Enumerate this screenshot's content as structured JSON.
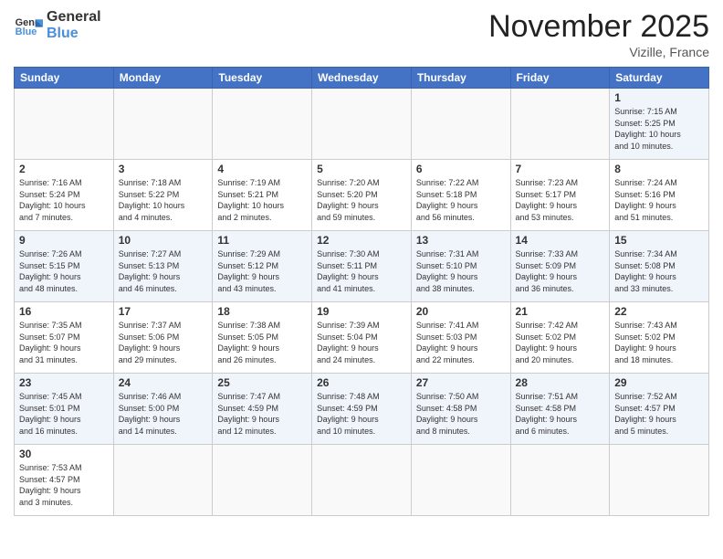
{
  "header": {
    "logo_general": "General",
    "logo_blue": "Blue",
    "month_title": "November 2025",
    "location": "Vizille, France"
  },
  "weekdays": [
    "Sunday",
    "Monday",
    "Tuesday",
    "Wednesday",
    "Thursday",
    "Friday",
    "Saturday"
  ],
  "weeks": [
    [
      {
        "day": "",
        "info": ""
      },
      {
        "day": "",
        "info": ""
      },
      {
        "day": "",
        "info": ""
      },
      {
        "day": "",
        "info": ""
      },
      {
        "day": "",
        "info": ""
      },
      {
        "day": "",
        "info": ""
      },
      {
        "day": "1",
        "info": "Sunrise: 7:15 AM\nSunset: 5:25 PM\nDaylight: 10 hours\nand 10 minutes."
      }
    ],
    [
      {
        "day": "2",
        "info": "Sunrise: 7:16 AM\nSunset: 5:24 PM\nDaylight: 10 hours\nand 7 minutes."
      },
      {
        "day": "3",
        "info": "Sunrise: 7:18 AM\nSunset: 5:22 PM\nDaylight: 10 hours\nand 4 minutes."
      },
      {
        "day": "4",
        "info": "Sunrise: 7:19 AM\nSunset: 5:21 PM\nDaylight: 10 hours\nand 2 minutes."
      },
      {
        "day": "5",
        "info": "Sunrise: 7:20 AM\nSunset: 5:20 PM\nDaylight: 9 hours\nand 59 minutes."
      },
      {
        "day": "6",
        "info": "Sunrise: 7:22 AM\nSunset: 5:18 PM\nDaylight: 9 hours\nand 56 minutes."
      },
      {
        "day": "7",
        "info": "Sunrise: 7:23 AM\nSunset: 5:17 PM\nDaylight: 9 hours\nand 53 minutes."
      },
      {
        "day": "8",
        "info": "Sunrise: 7:24 AM\nSunset: 5:16 PM\nDaylight: 9 hours\nand 51 minutes."
      }
    ],
    [
      {
        "day": "9",
        "info": "Sunrise: 7:26 AM\nSunset: 5:15 PM\nDaylight: 9 hours\nand 48 minutes."
      },
      {
        "day": "10",
        "info": "Sunrise: 7:27 AM\nSunset: 5:13 PM\nDaylight: 9 hours\nand 46 minutes."
      },
      {
        "day": "11",
        "info": "Sunrise: 7:29 AM\nSunset: 5:12 PM\nDaylight: 9 hours\nand 43 minutes."
      },
      {
        "day": "12",
        "info": "Sunrise: 7:30 AM\nSunset: 5:11 PM\nDaylight: 9 hours\nand 41 minutes."
      },
      {
        "day": "13",
        "info": "Sunrise: 7:31 AM\nSunset: 5:10 PM\nDaylight: 9 hours\nand 38 minutes."
      },
      {
        "day": "14",
        "info": "Sunrise: 7:33 AM\nSunset: 5:09 PM\nDaylight: 9 hours\nand 36 minutes."
      },
      {
        "day": "15",
        "info": "Sunrise: 7:34 AM\nSunset: 5:08 PM\nDaylight: 9 hours\nand 33 minutes."
      }
    ],
    [
      {
        "day": "16",
        "info": "Sunrise: 7:35 AM\nSunset: 5:07 PM\nDaylight: 9 hours\nand 31 minutes."
      },
      {
        "day": "17",
        "info": "Sunrise: 7:37 AM\nSunset: 5:06 PM\nDaylight: 9 hours\nand 29 minutes."
      },
      {
        "day": "18",
        "info": "Sunrise: 7:38 AM\nSunset: 5:05 PM\nDaylight: 9 hours\nand 26 minutes."
      },
      {
        "day": "19",
        "info": "Sunrise: 7:39 AM\nSunset: 5:04 PM\nDaylight: 9 hours\nand 24 minutes."
      },
      {
        "day": "20",
        "info": "Sunrise: 7:41 AM\nSunset: 5:03 PM\nDaylight: 9 hours\nand 22 minutes."
      },
      {
        "day": "21",
        "info": "Sunrise: 7:42 AM\nSunset: 5:02 PM\nDaylight: 9 hours\nand 20 minutes."
      },
      {
        "day": "22",
        "info": "Sunrise: 7:43 AM\nSunset: 5:02 PM\nDaylight: 9 hours\nand 18 minutes."
      }
    ],
    [
      {
        "day": "23",
        "info": "Sunrise: 7:45 AM\nSunset: 5:01 PM\nDaylight: 9 hours\nand 16 minutes."
      },
      {
        "day": "24",
        "info": "Sunrise: 7:46 AM\nSunset: 5:00 PM\nDaylight: 9 hours\nand 14 minutes."
      },
      {
        "day": "25",
        "info": "Sunrise: 7:47 AM\nSunset: 4:59 PM\nDaylight: 9 hours\nand 12 minutes."
      },
      {
        "day": "26",
        "info": "Sunrise: 7:48 AM\nSunset: 4:59 PM\nDaylight: 9 hours\nand 10 minutes."
      },
      {
        "day": "27",
        "info": "Sunrise: 7:50 AM\nSunset: 4:58 PM\nDaylight: 9 hours\nand 8 minutes."
      },
      {
        "day": "28",
        "info": "Sunrise: 7:51 AM\nSunset: 4:58 PM\nDaylight: 9 hours\nand 6 minutes."
      },
      {
        "day": "29",
        "info": "Sunrise: 7:52 AM\nSunset: 4:57 PM\nDaylight: 9 hours\nand 5 minutes."
      }
    ],
    [
      {
        "day": "30",
        "info": "Sunrise: 7:53 AM\nSunset: 4:57 PM\nDaylight: 9 hours\nand 3 minutes."
      },
      {
        "day": "",
        "info": ""
      },
      {
        "day": "",
        "info": ""
      },
      {
        "day": "",
        "info": ""
      },
      {
        "day": "",
        "info": ""
      },
      {
        "day": "",
        "info": ""
      },
      {
        "day": "",
        "info": ""
      }
    ]
  ]
}
